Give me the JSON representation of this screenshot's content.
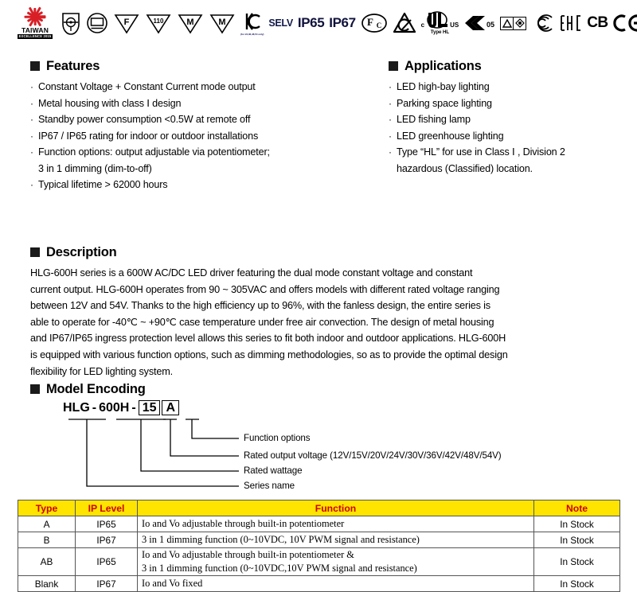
{
  "certifications": {
    "taiwan_logo": {
      "name": "TAIWAN",
      "sub": "EXCELLENCE 2015"
    },
    "marks": [
      {
        "id": "class-1-shield-icon",
        "label": ""
      },
      {
        "id": "independent-circuit-icon",
        "label": ""
      },
      {
        "id": "triangle-f-icon",
        "label": "F"
      },
      {
        "id": "triangle-110-icon",
        "label": "110"
      },
      {
        "id": "triangle-m-icon",
        "label": "M"
      },
      {
        "id": "triangle-m2-icon",
        "label": "M"
      }
    ],
    "kc_mark": {
      "label": "KC",
      "sub": "(for 24,36,48,54 only)"
    },
    "selv_label": "SELV",
    "ip65_label": "IP65",
    "ip67_label": "IP67",
    "fcc_label": "FC",
    "rcm_label": "RCM",
    "ul": {
      "c": "c",
      "us": "US",
      "type": "Type HL"
    },
    "emc_label": "EMC",
    "emc_year": "05",
    "ccc_label": "CCC",
    "eac_label": "EAC",
    "cb_label": "CB",
    "ce_label": "CE"
  },
  "features": {
    "title": "Features",
    "items": [
      {
        "text": "Constant Voltage + Constant Current mode output"
      },
      {
        "text": "Metal housing with class Ⅰ design"
      },
      {
        "text": "Standby power consumption <0.5W at remote off"
      },
      {
        "text": "IP67 / IP65 rating for indoor or outdoor installations"
      },
      {
        "text": "Function options: output adjustable via potentiometer;"
      },
      {
        "text": "3 in 1 dimming (dim-to-off)",
        "continuation": true
      },
      {
        "text": "Typical lifetime > 62000 hours"
      }
    ]
  },
  "applications": {
    "title": "Applications",
    "items": [
      {
        "text": "LED high-bay lighting"
      },
      {
        "text": "Parking space lighting"
      },
      {
        "text": "LED fishing lamp"
      },
      {
        "text": "LED greenhouse lighting"
      },
      {
        "text": "Type “HL” for use in Class Ⅰ , Division 2"
      },
      {
        "text": "hazardous (Classified) location.",
        "continuation": true
      }
    ]
  },
  "description": {
    "title": "Description",
    "lines": [
      "HLG-600H series is a 600W AC/DC LED driver featuring the dual mode constant voltage and constant",
      "current output. HLG-600H operates from 90 ~ 305VAC and offers models with different rated voltage ranging",
      "between 12V and 54V. Thanks to the high efficiency up to 96%, with the fanless design, the entire series is",
      "able to operate for -40℃ ~ +90℃  case temperature under free air convection. The design of metal housing",
      "and  IP67/IP65 ingress protection level allows this series to fit both indoor and outdoor applications. HLG-600H",
      "is equipped with various function options, such as dimming methodologies, so as to provide the optimal design",
      "flexibility for LED lighting system."
    ]
  },
  "model_encoding": {
    "title": "Model Encoding",
    "model": {
      "series": "HLG",
      "dash1": "-",
      "wattage": "600H",
      "dash2": "-",
      "voltage": "15",
      "option": "A"
    },
    "callouts": [
      {
        "label": "Function options"
      },
      {
        "label": "Rated output voltage (12V/15V/20V/24V/30V/36V/42V/48V/54V)"
      },
      {
        "label": "Rated wattage"
      },
      {
        "label": "Series name"
      }
    ]
  },
  "table": {
    "headers": [
      "Type",
      "IP Level",
      "Function",
      "Note"
    ],
    "rows": [
      {
        "type": "A",
        "ip": "IP65",
        "function": [
          "Io and Vo adjustable through built-in potentiometer"
        ],
        "note": "In Stock"
      },
      {
        "type": "B",
        "ip": "IP67",
        "function": [
          "3 in 1 dimming function (0~10VDC, 10V PWM signal and resistance)"
        ],
        "note": "In Stock"
      },
      {
        "type": "AB",
        "ip": "IP65",
        "function": [
          "Io and Vo adjustable through built-in potentiometer &",
          "3 in 1 dimming function (0~10VDC,10V  PWM  signal and resistance)"
        ],
        "note": "In Stock",
        "tall": true
      },
      {
        "type": "Blank",
        "ip": "IP67",
        "function": [
          "Io and Vo fixed"
        ],
        "note": "In Stock"
      }
    ]
  },
  "colors": {
    "header_bg": "#ffe400",
    "header_text": "#cc0000",
    "logo_red": "#d81f26",
    "ip_navy": "#10123c"
  }
}
